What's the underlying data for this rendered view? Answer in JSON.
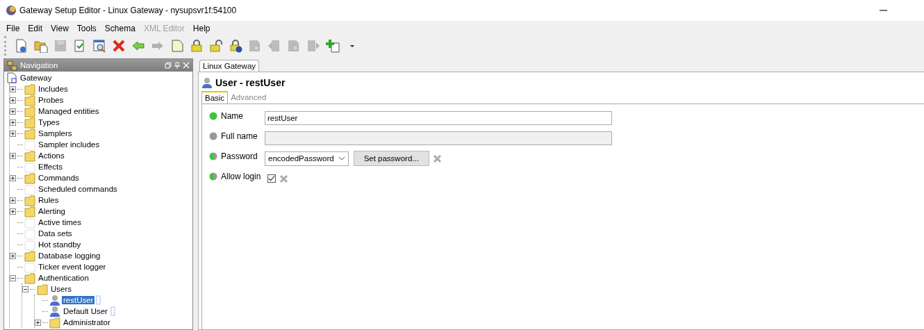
{
  "window": {
    "title": "Gateway Setup Editor - Linux Gateway - nysupsvr1f:54100"
  },
  "menu": [
    {
      "label": "File",
      "disabled": false
    },
    {
      "label": "Edit",
      "disabled": false
    },
    {
      "label": "View",
      "disabled": false
    },
    {
      "label": "Tools",
      "disabled": false
    },
    {
      "label": "Schema",
      "disabled": false
    },
    {
      "label": "XML Editor",
      "disabled": true
    },
    {
      "label": "Help",
      "disabled": false
    }
  ],
  "toolbar": [
    {
      "kind": "new",
      "disabled": false
    },
    {
      "kind": "open",
      "disabled": false
    },
    {
      "kind": "save",
      "disabled": true
    },
    {
      "kind": "validate",
      "disabled": false
    },
    {
      "kind": "preview",
      "disabled": false
    },
    {
      "kind": "delete",
      "disabled": false
    },
    {
      "kind": "back",
      "disabled": false
    },
    {
      "kind": "forward",
      "disabled": true
    },
    {
      "kind": "note",
      "disabled": false
    },
    {
      "kind": "lock",
      "disabled": false
    },
    {
      "kind": "unlock",
      "disabled": false
    },
    {
      "kind": "lockinfo",
      "disabled": false
    },
    {
      "kind": "docsearch",
      "disabled": true
    },
    {
      "kind": "docleft",
      "disabled": true
    },
    {
      "kind": "docsearch",
      "disabled": true
    },
    {
      "kind": "docright",
      "disabled": true
    },
    {
      "kind": "add",
      "disabled": false
    },
    {
      "kind": "caret",
      "disabled": false
    }
  ],
  "navigation": {
    "title": "Navigation",
    "tree": [
      {
        "label": "Gateway",
        "kind": "root",
        "selected": false,
        "children": [
          {
            "label": "Includes",
            "kind": "folder",
            "expanded": false,
            "selected": false
          },
          {
            "label": "Probes",
            "kind": "folder",
            "expanded": false,
            "selected": false
          },
          {
            "label": "Managed entities",
            "kind": "folder",
            "expanded": false,
            "selected": false
          },
          {
            "label": "Types",
            "kind": "folder",
            "expanded": false,
            "selected": false
          },
          {
            "label": "Samplers",
            "kind": "folder",
            "expanded": false,
            "selected": false
          },
          {
            "label": "Sampler includes",
            "kind": "blank",
            "selected": false
          },
          {
            "label": "Actions",
            "kind": "folder",
            "expanded": false,
            "selected": false
          },
          {
            "label": "Effects",
            "kind": "blank",
            "selected": false
          },
          {
            "label": "Commands",
            "kind": "folder",
            "expanded": false,
            "selected": false
          },
          {
            "label": "Scheduled commands",
            "kind": "blank",
            "selected": false
          },
          {
            "label": "Rules",
            "kind": "folder",
            "expanded": false,
            "selected": false
          },
          {
            "label": "Alerting",
            "kind": "folder",
            "expanded": false,
            "selected": false
          },
          {
            "label": "Active times",
            "kind": "blank",
            "selected": false
          },
          {
            "label": "Data sets",
            "kind": "blank",
            "selected": false
          },
          {
            "label": "Hot standby",
            "kind": "blank",
            "selected": false
          },
          {
            "label": "Database logging",
            "kind": "folder",
            "expanded": false,
            "selected": false
          },
          {
            "label": "Ticker event logger",
            "kind": "blank",
            "selected": false
          },
          {
            "label": "Authentication",
            "kind": "folder",
            "expanded": true,
            "selected": false,
            "children": [
              {
                "label": "Users",
                "kind": "folder",
                "expanded": true,
                "selected": false,
                "children": [
                  {
                    "label": "restUser",
                    "kind": "user",
                    "selected": true
                  },
                  {
                    "label": "Default User",
                    "kind": "user",
                    "selected": false
                  },
                  {
                    "label": "Administrator",
                    "kind": "folder",
                    "expanded": false,
                    "selected": false
                  }
                ]
              }
            ]
          }
        ]
      }
    ]
  },
  "document_tab": {
    "label": "Linux Gateway",
    "selected": true
  },
  "editor": {
    "title": "User - restUser",
    "tabs": [
      {
        "label": "Basic",
        "selected": true
      },
      {
        "label": "Advanced",
        "selected": false
      }
    ],
    "fields": [
      {
        "label": "Name",
        "valid": true,
        "complete": true,
        "kind": "text",
        "value": "restUser"
      },
      {
        "label": "Full name",
        "valid": false,
        "complete": false,
        "kind": "text"
      },
      {
        "label": "Password",
        "valid": true,
        "complete": false,
        "kind": "select",
        "value": "encodedPassword",
        "button": "Set password..."
      },
      {
        "label": "Allow login",
        "valid": true,
        "complete": false,
        "kind": "checkbox",
        "checked": true
      }
    ]
  }
}
